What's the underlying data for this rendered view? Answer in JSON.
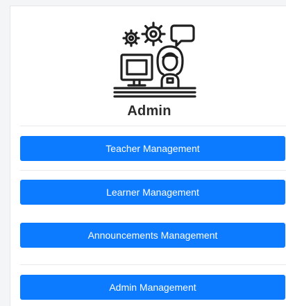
{
  "profile": {
    "title": "Admin",
    "icon": "admin-workstation-icon"
  },
  "menu": {
    "items": [
      {
        "label": "Teacher Management"
      },
      {
        "label": "Learner Management"
      },
      {
        "label": "Announcements Management"
      },
      {
        "label": "Admin Management"
      }
    ]
  },
  "colors": {
    "button": "#0d7bff",
    "button_text": "#ffffff",
    "title": "#2b2b2b",
    "icon_stroke": "#1f1f1f",
    "background": "#f4f5f7"
  }
}
